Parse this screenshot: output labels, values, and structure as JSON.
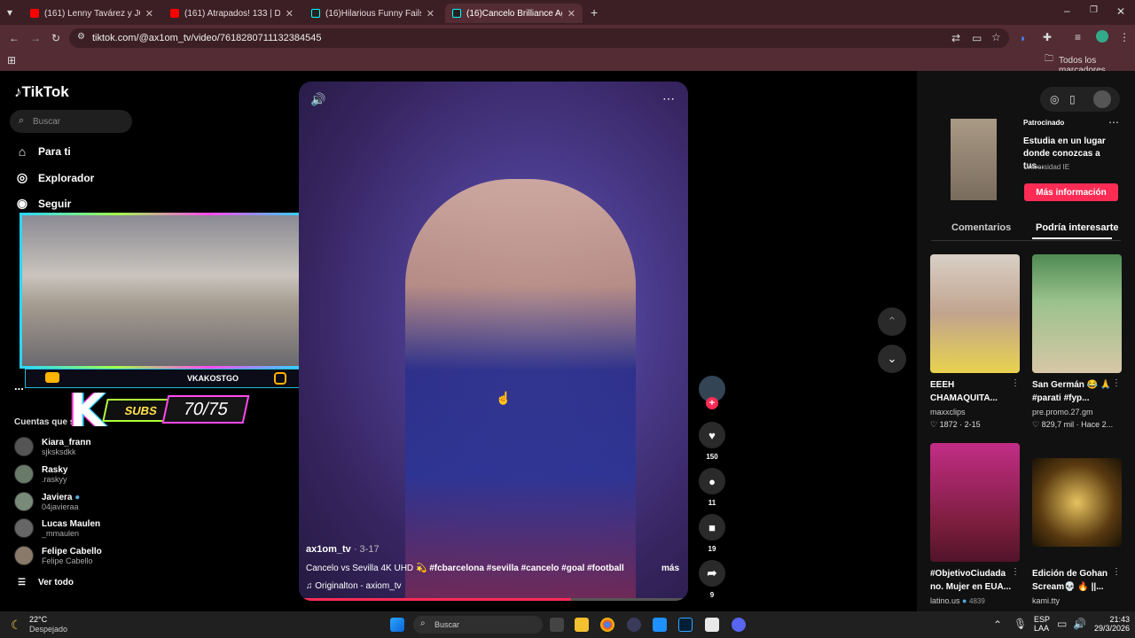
{
  "browser": {
    "tabs": [
      {
        "label": "(161) Lenny Tavárez y JQuiles e"
      },
      {
        "label": "(161) Atrapados! 133 | Delincue"
      },
      {
        "label": "(16)Hilarious Funny Fails Comp"
      },
      {
        "label": "(16)Cancelo Brilliance Agai"
      }
    ],
    "url": "tiktok.com/@ax1om_tv/video/7618280711132384545",
    "bookmarks_label": "Todos los marcadores"
  },
  "tiktok": {
    "logo": "TikTok",
    "search_placeholder": "Buscar",
    "nav": {
      "for_you": "Para ti",
      "explore": "Explorador",
      "following": "Seguir",
      "more": "..."
    },
    "following_title": "Cuentas que si",
    "accounts": [
      {
        "name": "Kiara_frann",
        "handle": "sjksksdkk"
      },
      {
        "name": "Rasky",
        "handle": ".raskyy"
      },
      {
        "name": "Javiera",
        "handle": "04javieraa"
      },
      {
        "name": "Lucas Maulen",
        "handle": "_mmaulen"
      },
      {
        "name": "Felipe Cabello",
        "handle": "Felipe Cabello"
      }
    ],
    "see_all": "Ver todo"
  },
  "stream_overlay": {
    "channel": "VKAKOSTGO",
    "label": "SUBS",
    "count": "70/75"
  },
  "video": {
    "author": "ax1om_tv",
    "date": "· 3-17",
    "caption": "Cancelo vs Sevilla 4K UHD",
    "emoji": "💫",
    "hashtags": "#fcbarcelona #sevilla #cancelo #goal #football",
    "more": "más",
    "sound": "Originalton - axiom_tv",
    "progress": 0.7,
    "likes": "150",
    "comments": "11",
    "saves": "19",
    "shares": "9"
  },
  "right_panel": {
    "ad": {
      "sponsored": "Patrocinado",
      "title": "Estudia en un lugar donde conozcas a tus...",
      "advertiser": "Universidad IE",
      "cta": "Más información"
    },
    "tabs": {
      "comments": "Comentarios",
      "suggested": "Podría interesarte"
    },
    "cards": [
      {
        "title": "EEEH CHAMAQUITA...",
        "author": "maxxclips",
        "likes": "1872",
        "date": "2-15"
      },
      {
        "title": "San Germán 😂 🙏 #parati #fyp...",
        "author": "pre.promo.27.gm",
        "likes": "829,7 mil",
        "date": "Hace 2..."
      },
      {
        "title": "#ObjetivoCiudada no. Mujer en EUA...",
        "author": "latino.us",
        "likes": "4839"
      },
      {
        "title": "Edición de Gohan Scream💀 🔥 ||...",
        "author": "kami.tty"
      }
    ]
  },
  "taskbar": {
    "weather_temp": "22°C",
    "weather_text": "Despejado",
    "search": "Buscar",
    "lang": "ESP",
    "lang2": "LAA",
    "time": "21:43",
    "date": "29/3/2026"
  }
}
